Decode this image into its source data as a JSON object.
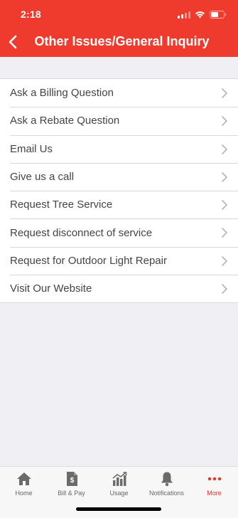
{
  "status_bar": {
    "time": "2:18"
  },
  "nav": {
    "title": "Other Issues/General Inquiry"
  },
  "menu": {
    "items": [
      {
        "label": "Ask a Billing Question"
      },
      {
        "label": "Ask a Rebate Question"
      },
      {
        "label": "Email Us"
      },
      {
        "label": "Give us a call"
      },
      {
        "label": "Request Tree Service"
      },
      {
        "label": "Request disconnect of service"
      },
      {
        "label": "Request for Outdoor Light Repair"
      },
      {
        "label": "Visit Our Website"
      }
    ]
  },
  "tab_bar": {
    "tabs": [
      {
        "label": "Home",
        "icon": "home-icon"
      },
      {
        "label": "Bill & Pay",
        "icon": "bill-icon"
      },
      {
        "label": "Usage",
        "icon": "usage-chart-icon"
      },
      {
        "label": "Notifications",
        "icon": "bell-icon"
      },
      {
        "label": "More",
        "icon": "more-dots-icon"
      }
    ],
    "active": "More"
  },
  "colors": {
    "brand": "#ef3a2e",
    "active_tab": "#e8322a",
    "inactive_tab": "#666666",
    "background": "#efeff4"
  }
}
